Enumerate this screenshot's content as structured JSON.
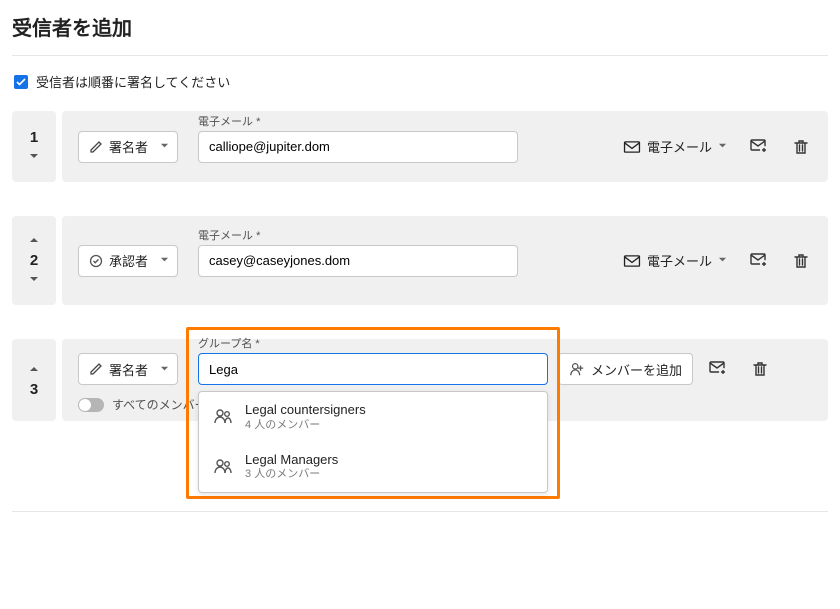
{
  "title": "受信者を追加",
  "sign_in_order_label": "受信者は順番に署名してください",
  "field_email_label": "電子メール *",
  "field_group_label": "グループ名 *",
  "delivery_email_label": "電子メール",
  "role_signer_label": "署名者",
  "role_approver_label": "承認者",
  "add_member_label": "メンバーを追加",
  "all_members_label": "すべてのメンバー",
  "rows": [
    {
      "order": "1",
      "role": "signer",
      "email": "calliope@jupiter.dom"
    },
    {
      "order": "2",
      "role": "approver",
      "email": "casey@caseyjones.dom"
    },
    {
      "order": "3",
      "role": "signer",
      "group_query": "Lega"
    }
  ],
  "suggestions": [
    {
      "name": "Legal countersigners",
      "members": "4 人のメンバー"
    },
    {
      "name": "Legal Managers",
      "members": "3 人のメンバー"
    }
  ]
}
